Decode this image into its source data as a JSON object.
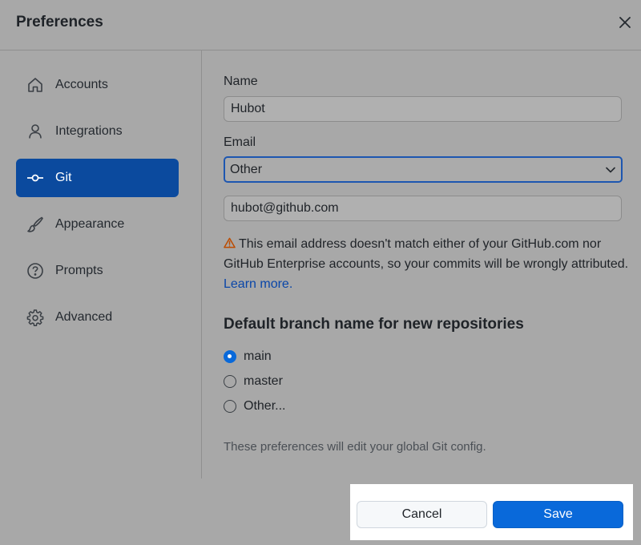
{
  "dialog": {
    "title": "Preferences"
  },
  "sidebar": {
    "items": [
      {
        "label": "Accounts",
        "icon": "home-icon"
      },
      {
        "label": "Integrations",
        "icon": "person-icon"
      },
      {
        "label": "Git",
        "icon": "git-commit-icon",
        "active": true
      },
      {
        "label": "Appearance",
        "icon": "paintbrush-icon"
      },
      {
        "label": "Prompts",
        "icon": "question-icon"
      },
      {
        "label": "Advanced",
        "icon": "gear-icon"
      }
    ]
  },
  "git": {
    "name_label": "Name",
    "name_value": "Hubot",
    "email_label": "Email",
    "email_select_value": "Other",
    "email_value": "hubot@github.com",
    "warning_text": "This email address doesn't match either of your GitHub.com nor GitHub Enterprise accounts, so your commits will be wrongly attributed.",
    "warning_link": "Learn more.",
    "branch_section_title": "Default branch name for new repositories",
    "branch_options": [
      {
        "label": "main",
        "checked": true
      },
      {
        "label": "master",
        "checked": false
      },
      {
        "label": "Other...",
        "checked": false
      }
    ],
    "note": "These preferences will edit your global Git config."
  },
  "footer": {
    "cancel_label": "Cancel",
    "save_label": "Save"
  },
  "colors": {
    "accent": "#0969da",
    "active_nav": "#0b4a9e",
    "link": "#0a46a8",
    "warning": "#bc4c00"
  }
}
